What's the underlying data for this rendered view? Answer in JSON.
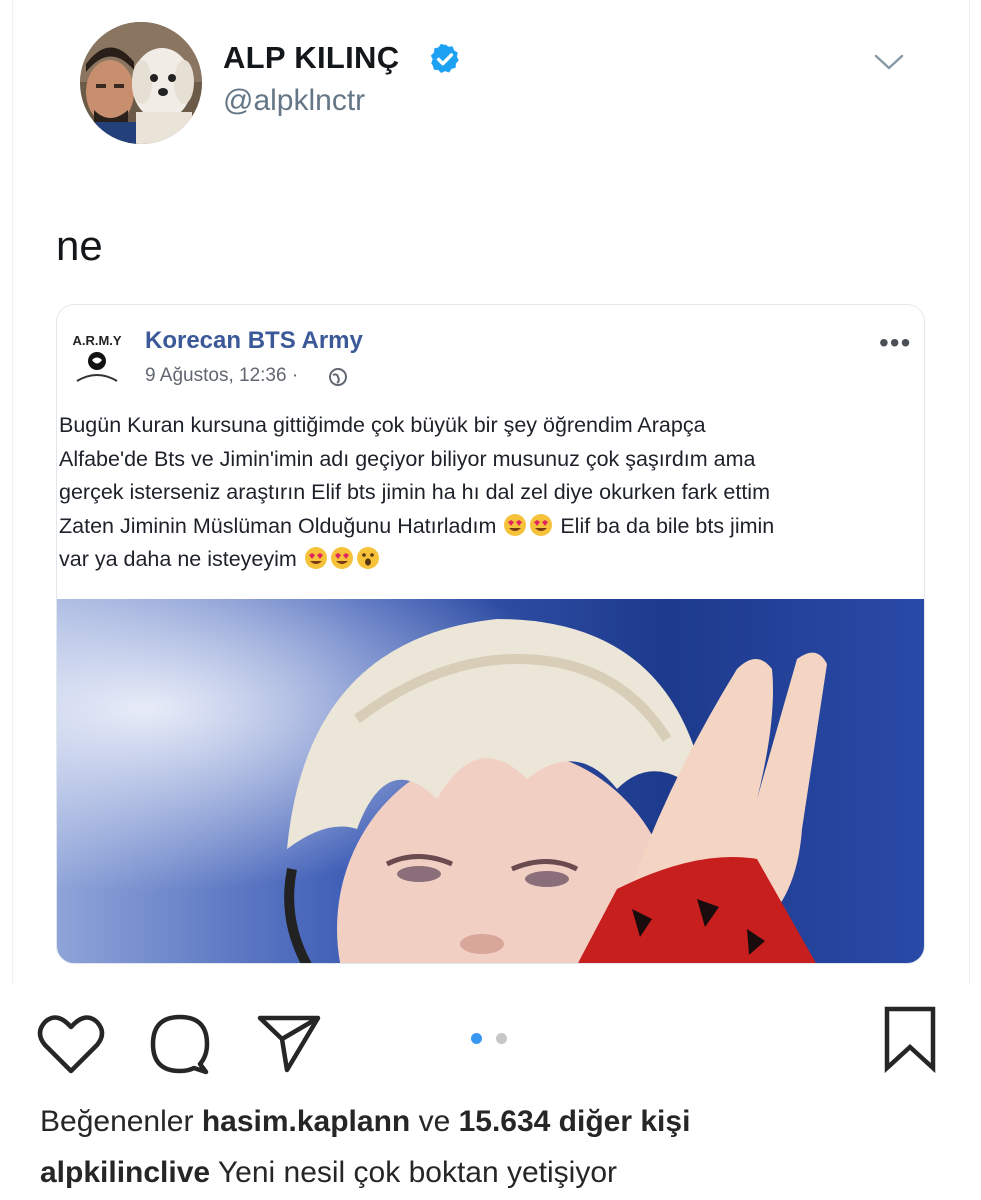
{
  "tweet": {
    "display_name": "ALP KILINÇ",
    "handle": "@alpklnctr",
    "text": "ne",
    "verified_icon": "verified-badge-icon",
    "menu_icon": "chevron-down-icon"
  },
  "embedded_post": {
    "page_logo_text": "A.R.M.Y",
    "page_name": "Korecan BTS Army",
    "timestamp": "9 Ağustos, 12:36 ·",
    "more_label": "•••",
    "lines": [
      "Bugün Kuran kursuna gittiğimde çok büyük bir şey öğrendim Arapça",
      "Alfabe'de Bts ve Jimin'imin adı geçiyor biliyor musunuz çok şaşırdım ama",
      "gerçek isterseniz araştırın Elif bts jimin ha hı dal zel diye okurken fark ettim",
      "Zaten Jiminin Müslüman Olduğunu Hatırladım",
      "Elif ba da bile bts jimin",
      "var ya daha ne isteyeyim"
    ]
  },
  "instagram": {
    "likes_prefix": "Beğenenler",
    "liker": "hasim.kaplann",
    "likes_conj": "ve",
    "likes_count": "15.634 diğer kişi",
    "caption_user": "alpkilinclive",
    "caption_text": "Yeni nesil çok boktan yetişiyor",
    "carousel": {
      "current": 1,
      "total": 2
    },
    "colors": {
      "active_dot": "#3897f0",
      "inactive_dot": "#c7c7c7",
      "text": "#262626"
    }
  }
}
